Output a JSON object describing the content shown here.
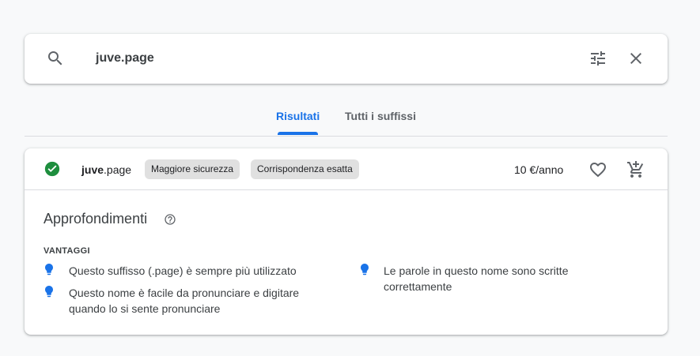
{
  "search": {
    "value": "juve.page",
    "search_icon": "search-icon",
    "filter_icon": "tune-icon",
    "close_icon": "close-icon"
  },
  "tabs": [
    {
      "label": "Risultati",
      "active": true
    },
    {
      "label": "Tutti i suffissi",
      "active": false
    }
  ],
  "result": {
    "status_icon": "check-circle-icon",
    "domain_sld": "juve",
    "domain_tld": ".page",
    "chips": [
      "Maggiore sicurezza",
      "Corrispondenza esatta"
    ],
    "price": "10 €/anno",
    "favorite_icon": "heart-icon",
    "cart_icon": "add-to-cart-icon"
  },
  "insights": {
    "title": "Approfondimenti",
    "help_icon": "help-icon",
    "advantages_label": "VANTAGGI",
    "benefits": [
      "Questo suffisso (.page) è sempre più utilizzato",
      "Questo nome è facile da pronunciare e digitare quando lo si sente pronunciare",
      "Le parole in questo nome sono scritte correttamente"
    ]
  },
  "colors": {
    "accent": "#1a73e8",
    "success": "#1e8e3e",
    "bulb": "#1a73e8",
    "chip_bg": "#e0e0e0"
  }
}
